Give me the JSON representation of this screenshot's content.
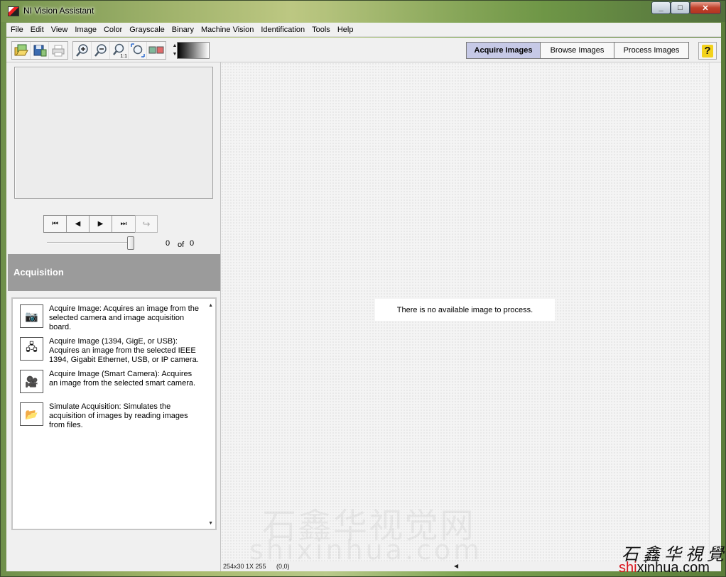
{
  "window": {
    "title": "NI Vision Assistant",
    "controls": [
      "_",
      "□",
      "✕"
    ]
  },
  "menu": [
    "File",
    "Edit",
    "View",
    "Image",
    "Color",
    "Grayscale",
    "Binary",
    "Machine Vision",
    "Identification",
    "Tools",
    "Help"
  ],
  "toolbar": {
    "icons": [
      "open-image-icon",
      "save-image-icon",
      "print-icon",
      "zoom-in-icon",
      "zoom-out-icon",
      "zoom-1to1-icon",
      "zoom-fit-icon",
      "image-palette-icon"
    ],
    "zoom_1to1_label": "1:1"
  },
  "modes": {
    "acquire": "Acquire Images",
    "browse": "Browse Images",
    "process": "Process Images",
    "active": "Acquire Images"
  },
  "help": {
    "label": "?"
  },
  "navigator": {
    "current": "0",
    "of_label": "of",
    "total": "0"
  },
  "section": {
    "title": "Acquisition"
  },
  "steps": [
    {
      "text": "Acquire Image:  Acquires an image from the selected camera and image acquisition board.",
      "icon": "camera-icon"
    },
    {
      "text": "Acquire Image (1394, GigE, or USB):  Acquires an image from the selected IEEE 1394, Gigabit Ethernet, USB, or IP camera.",
      "icon": "network-camera-icon"
    },
    {
      "text": "Acquire Image (Smart Camera):  Acquires an image from the selected smart camera.",
      "icon": "smart-camera-icon"
    },
    {
      "text": "Simulate Acquisition:  Simulates the acquisition of images by reading images from files.",
      "icon": "folder-image-icon"
    }
  ],
  "main": {
    "empty_message": "There is no available image to process."
  },
  "status": {
    "resolution": "254x30 1X 255",
    "coords": "(0,0)"
  },
  "watermark": {
    "cn": "石鑫华视觉网",
    "en": "shixinhua.com"
  },
  "brand": {
    "cn": "石鑫华視覺",
    "en_red": "shi",
    "en_black": "xinhua.com"
  },
  "colors": {
    "active_tab": "#c6c9e6",
    "section_header": "#9b9b9b",
    "close_button": "#c0412b",
    "brand_red": "#d9141b"
  }
}
